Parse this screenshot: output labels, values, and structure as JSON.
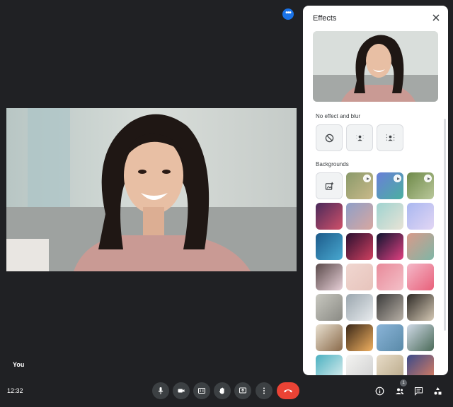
{
  "main": {
    "self_label": "You"
  },
  "effects_panel": {
    "title": "Effects",
    "section_no_effect": "No effect and blur",
    "section_backgrounds": "Backgrounds",
    "no_effect_options": [
      "no-effect",
      "slight-blur",
      "blur"
    ],
    "backgrounds": [
      {
        "kind": "upload"
      },
      {
        "kind": "video",
        "c1": "#8a9a6a",
        "c2": "#c9b98a"
      },
      {
        "kind": "video",
        "c1": "#6a7fd8",
        "c2": "#4ab0a0"
      },
      {
        "kind": "video",
        "c1": "#6f8a4a",
        "c2": "#b9c79a"
      },
      {
        "kind": "image",
        "c1": "#4a2a5a",
        "c2": "#d0506a"
      },
      {
        "kind": "image",
        "c1": "#8e9fc8",
        "c2": "#d8a7a0"
      },
      {
        "kind": "image",
        "c1": "#9fd3d0",
        "c2": "#e8e3d6"
      },
      {
        "kind": "image",
        "c1": "#a9b7f0",
        "c2": "#e2d6f4"
      },
      {
        "kind": "image",
        "c1": "#1d5b8a",
        "c2": "#48a8d0"
      },
      {
        "kind": "image",
        "c1": "#2a1030",
        "c2": "#d04060"
      },
      {
        "kind": "image",
        "c1": "#0e1430",
        "c2": "#e04080"
      },
      {
        "kind": "image",
        "c1": "#d89a8a",
        "c2": "#7fb6a6"
      },
      {
        "kind": "image",
        "c1": "#5a4a4a",
        "c2": "#e8d0d8"
      },
      {
        "kind": "image",
        "c1": "#f0d6d0",
        "c2": "#e7c4bc"
      },
      {
        "kind": "image",
        "c1": "#e88a9a",
        "c2": "#f4c0c8"
      },
      {
        "kind": "image",
        "c1": "#f4b8c8",
        "c2": "#e8607a"
      },
      {
        "kind": "image",
        "c1": "#c8c8c0",
        "c2": "#8a8a84"
      },
      {
        "kind": "image",
        "c1": "#9aa6ae",
        "c2": "#e8ebee"
      },
      {
        "kind": "image",
        "c1": "#3a3a3a",
        "c2": "#b8b0a6"
      },
      {
        "kind": "image",
        "c1": "#2e2a26",
        "c2": "#d4c8b4"
      },
      {
        "kind": "image",
        "c1": "#e8e0d0",
        "c2": "#8a6a4a"
      },
      {
        "kind": "image",
        "c1": "#3a2818",
        "c2": "#f0b060"
      },
      {
        "kind": "image",
        "c1": "#8ab4d8",
        "c2": "#5a8aa8"
      },
      {
        "kind": "image",
        "c1": "#cfd9e6",
        "c2": "#4a6a58"
      },
      {
        "kind": "image",
        "c1": "#4ab0c0",
        "c2": "#e0f0f0"
      },
      {
        "kind": "image",
        "c1": "#f4f4f2",
        "c2": "#cfcfcf"
      },
      {
        "kind": "image",
        "c1": "#e8dcc8",
        "c2": "#b8a888"
      },
      {
        "kind": "image",
        "c1": "#3a4a8a",
        "c2": "#e08060"
      }
    ]
  },
  "footer": {
    "clock": "12:32",
    "participant_count": "1"
  },
  "colors": {
    "background": "#202124",
    "control": "#3c4043",
    "end_call": "#ea4335",
    "accent": "#1a73e8"
  }
}
